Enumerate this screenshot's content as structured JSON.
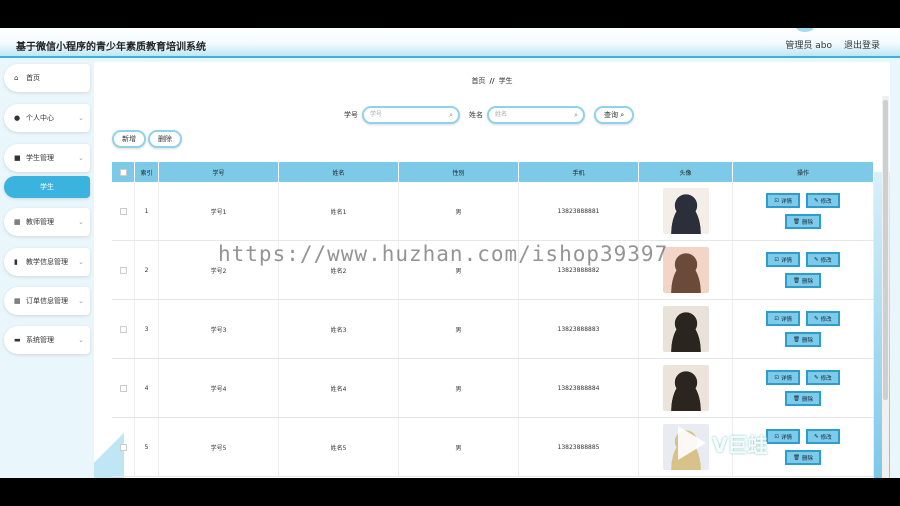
{
  "header": {
    "title": "基于微信小程序的青少年素质教育培训系统",
    "user": "管理员 abo",
    "logout": "退出登录"
  },
  "sidebar": {
    "items": [
      {
        "label": "首页",
        "icon": "home-icon",
        "chevron": false
      },
      {
        "label": "个人中心",
        "icon": "user-icon",
        "chevron": true
      },
      {
        "label": "学生管理",
        "icon": "student-icon",
        "chevron": true
      },
      {
        "label": "学生",
        "active": true
      },
      {
        "label": "教师管理",
        "icon": "grid-icon",
        "chevron": true
      },
      {
        "label": "教学信息管理",
        "icon": "chart-icon",
        "chevron": true
      },
      {
        "label": "订单信息管理",
        "icon": "grid-icon",
        "chevron": true
      },
      {
        "label": "系统管理",
        "icon": "system-icon",
        "chevron": true
      }
    ]
  },
  "breadcrumb": {
    "home": "首页",
    "sep": "//",
    "current": "学生"
  },
  "search": {
    "xuehao_label": "学号",
    "xuehao_placeholder": "学号",
    "name_label": "姓名",
    "name_placeholder": "姓名",
    "query_button": "查询"
  },
  "ops": {
    "add": "新增",
    "delete": "删除"
  },
  "table": {
    "headers": [
      "",
      "索引",
      "学号",
      "姓名",
      "性别",
      "手机",
      "头像",
      "操作"
    ],
    "rows": [
      {
        "index": "1",
        "xuehao": "学号1",
        "name": "姓名1",
        "gender": "男",
        "phone": "13823888881"
      },
      {
        "index": "2",
        "xuehao": "学号2",
        "name": "姓名2",
        "gender": "男",
        "phone": "13823888882"
      },
      {
        "index": "3",
        "xuehao": "学号3",
        "name": "姓名3",
        "gender": "男",
        "phone": "13823888883"
      },
      {
        "index": "4",
        "xuehao": "学号4",
        "name": "姓名4",
        "gender": "男",
        "phone": "13823888884"
      },
      {
        "index": "5",
        "xuehao": "学号5",
        "name": "姓名5",
        "gender": "男",
        "phone": "13823888885"
      }
    ],
    "actions": {
      "detail": "详情",
      "edit": "修改",
      "remove": "删除"
    }
  },
  "watermark": "https://www.huzhan.com/ishop39397",
  "logo_text": "V巨蛙",
  "colors": {
    "accent": "#3ab3df",
    "header_bg": "#7cc9e8"
  }
}
